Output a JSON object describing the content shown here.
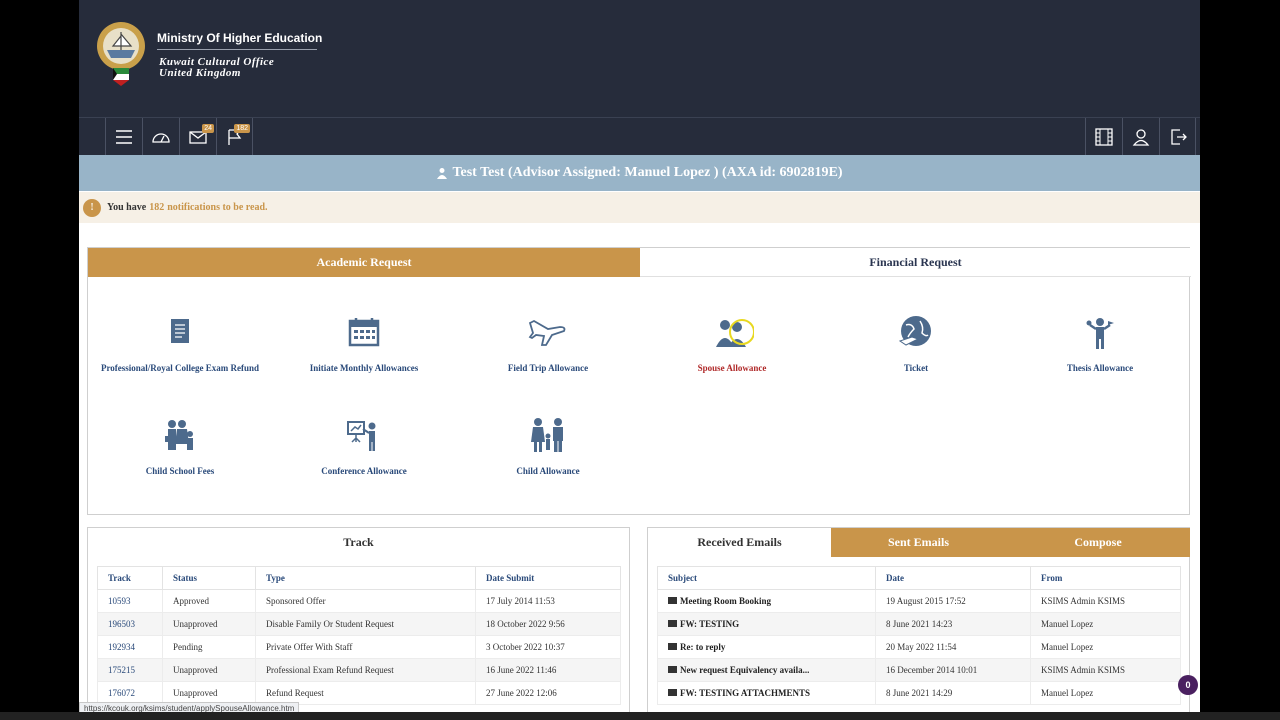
{
  "brand": {
    "title": "Ministry Of Higher Education",
    "sub1": "Kuwait Cultural Office",
    "sub2": "United Kingdom"
  },
  "toolbar": {
    "mail_badge": "24",
    "flag_badge": "182"
  },
  "user": {
    "title": "Test Test (Advisor Assigned: Manuel Lopez ) (AXA id: 6902819E)"
  },
  "notification": {
    "prefix": "You have",
    "count": "182",
    "suffix": "notifications to be read."
  },
  "requests": {
    "tabs": [
      "Academic Request",
      "Financial Request"
    ],
    "items": [
      {
        "label": "Professional/Royal College Exam Refund",
        "icon": "document-icon"
      },
      {
        "label": "Initiate Monthly Allowances",
        "icon": "calendar-icon"
      },
      {
        "label": "Field Trip Allowance",
        "icon": "airplane-icon"
      },
      {
        "label": "Spouse Allowance",
        "icon": "couple-icon"
      },
      {
        "label": "Ticket",
        "icon": "globe-plane-icon"
      },
      {
        "label": "Thesis Allowance",
        "icon": "graduate-icon"
      },
      {
        "label": "Child School Fees",
        "icon": "family-icon"
      },
      {
        "label": "Conference Allowance",
        "icon": "presentation-icon"
      },
      {
        "label": "Child Allowance",
        "icon": "parent-child-icon"
      }
    ]
  },
  "track": {
    "title": "Track",
    "headers": [
      "Track",
      "Status",
      "Type",
      "Date Submit"
    ],
    "rows": [
      [
        "10593",
        "Approved",
        "Sponsored Offer",
        "17 July 2014 11:53"
      ],
      [
        "196503",
        "Unapproved",
        "Disable Family Or Student Request",
        "18 October 2022 9:56"
      ],
      [
        "192934",
        "Pending",
        "Private Offer With Staff",
        "3 October 2022 10:37"
      ],
      [
        "175215",
        "Unapproved",
        "Professional Exam Refund Request",
        "16 June 2022 11:46"
      ],
      [
        "176072",
        "Unapproved",
        "Refund Request",
        "27 June 2022 12:06"
      ]
    ]
  },
  "emails": {
    "tabs": [
      "Received Emails",
      "Sent Emails",
      "Compose"
    ],
    "headers": [
      "Subject",
      "Date",
      "From"
    ],
    "rows": [
      [
        "Meeting Room Booking",
        "19 August 2015 17:52",
        "KSIMS Admin KSIMS"
      ],
      [
        "FW: TESTING",
        "8 June 2021 14:23",
        "Manuel Lopez"
      ],
      [
        "Re: to reply",
        "20 May 2022 11:54",
        "Manuel Lopez"
      ],
      [
        "New request Equivalency availa...",
        "16 December 2014 10:01",
        "KSIMS Admin KSIMS"
      ],
      [
        "FW: TESTING ATTACHMENTS",
        "8 June 2021 14:29",
        "Manuel Lopez"
      ]
    ]
  },
  "chat_badge": "0",
  "status_url": "https://kcouk.org/ksims/student/applySpouseAllowance.htm",
  "colors": {
    "header": "#262c3b",
    "accent": "#c9954a",
    "userbar": "#98b4c8",
    "link": "#2a4a7a",
    "active": "#b02a2a"
  }
}
